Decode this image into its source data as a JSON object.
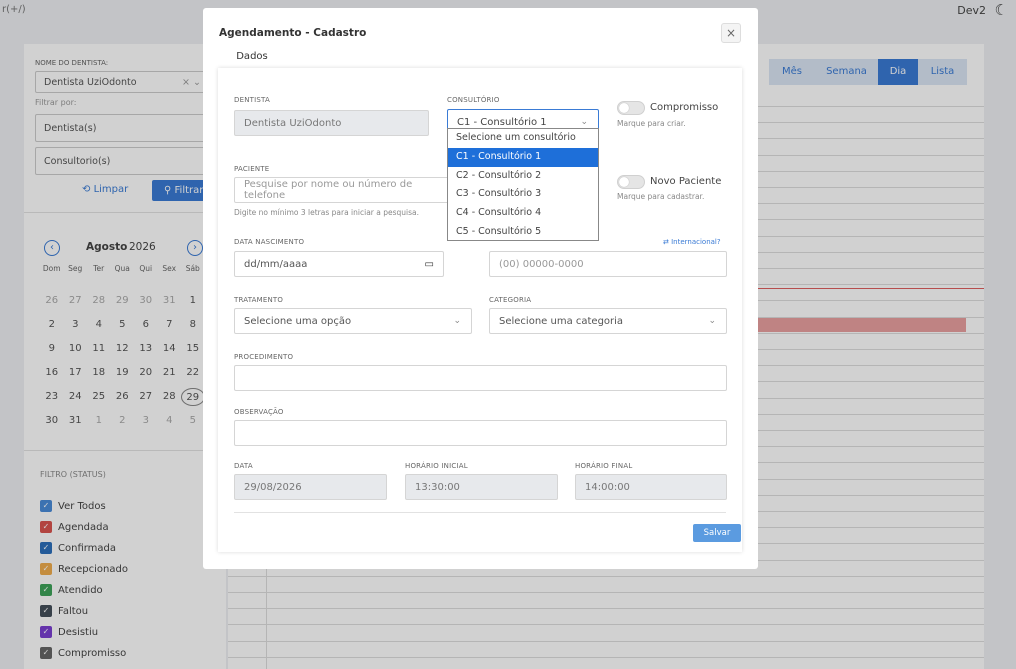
{
  "topbar": {
    "left_text": "r(+/)",
    "user": "Dev2"
  },
  "left": {
    "dentist_label": "NOME DO DENTISTA:",
    "dentist_value": "Dentista UziOdonto",
    "filter_label": "Filtrar por:",
    "filter_dentists": "Dentista(s)",
    "filter_offices": "Consultorio(s)",
    "clear_button": "Limpar",
    "filter_button": "Filtrar"
  },
  "calendar": {
    "month": "Agosto",
    "year": "2026",
    "weekdays": [
      "Dom",
      "Seg",
      "Ter",
      "Qua",
      "Qui",
      "Sex",
      "Sáb"
    ],
    "rows": [
      [
        "26",
        "27",
        "28",
        "29",
        "30",
        "31",
        "1"
      ],
      [
        "2",
        "3",
        "4",
        "5",
        "6",
        "7",
        "8"
      ],
      [
        "9",
        "10",
        "11",
        "12",
        "13",
        "14",
        "15"
      ],
      [
        "16",
        "17",
        "18",
        "19",
        "20",
        "21",
        "22"
      ],
      [
        "23",
        "24",
        "25",
        "26",
        "27",
        "28",
        "29"
      ],
      [
        "30",
        "31",
        "1",
        "2",
        "3",
        "4",
        "5"
      ]
    ]
  },
  "status_filter": {
    "title": "FILTRO (STATUS)",
    "items": [
      {
        "label": "Ver Todos",
        "color": "#4a8bd8"
      },
      {
        "label": "Agendada",
        "color": "#d9534f"
      },
      {
        "label": "Confirmada",
        "color": "#2c6fbb"
      },
      {
        "label": "Recepcionado",
        "color": "#f0ad4e"
      },
      {
        "label": "Atendido",
        "color": "#3ea35a"
      },
      {
        "label": "Faltou",
        "color": "#444f5a"
      },
      {
        "label": "Desistiu",
        "color": "#7b3fd1"
      },
      {
        "label": "Compromisso",
        "color": "#666666"
      }
    ]
  },
  "views": {
    "month": "Mês",
    "week": "Semana",
    "day": "Dia",
    "list": "Lista"
  },
  "modal": {
    "title": "Agendamento - Cadastro",
    "tab": "Dados",
    "close": "×",
    "dentist_label": "DENTISTA",
    "dentist_value": "Dentista UziOdonto",
    "office_label": "CONSULTÓRIO",
    "office_value": "C1 - Consultório 1",
    "office_options": [
      "Selecione um consultório",
      "C1 - Consultório 1",
      "C2 - Consultório 2",
      "C3 - Consultório 3",
      "C4 - Consultório 4",
      "C5 - Consultório 5"
    ],
    "commitment_label": "Compromisso",
    "commitment_help": "Marque para criar.",
    "patient_label": "PACIENTE",
    "patient_placeholder": "Pesquise por nome ou número de telefone",
    "patient_help": "Digite no mínimo 3 letras para iniciar a pesquisa.",
    "new_patient_label": "Novo Paciente",
    "new_patient_help": "Marque para cadastrar.",
    "birth_label": "DATA NASCIMENTO",
    "birth_placeholder": "dd/mm/aaaa",
    "international_link": "Internacional?",
    "phone_placeholder": "(00) 00000-0000",
    "treatment_label": "TRATAMENTO",
    "treatment_placeholder": "Selecione uma opção",
    "category_label": "CATEGORIA",
    "category_placeholder": "Selecione uma categoria",
    "procedure_label": "PROCEDIMENTO",
    "note_label": "OBSERVAÇÃO",
    "date_label": "DATA",
    "date_value": "29/08/2026",
    "start_label": "HORÁRIO INICIAL",
    "start_value": "13:30:00",
    "end_label": "HORÁRIO FINAL",
    "end_value": "14:00:00",
    "save_button": "Salvar"
  }
}
